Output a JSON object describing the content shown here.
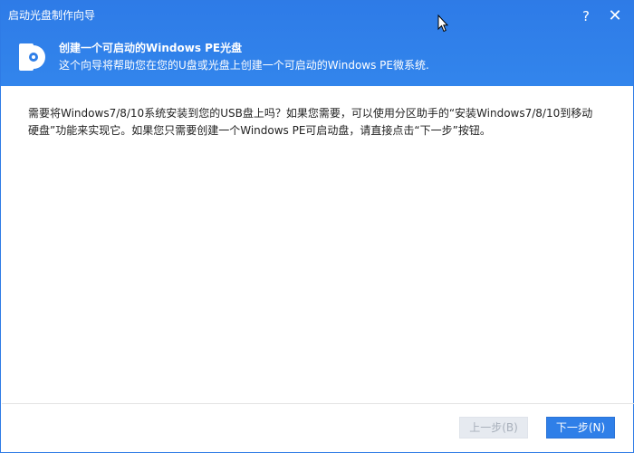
{
  "window": {
    "title": "启动光盘制作向导",
    "help_label": "?",
    "close_label": "✕"
  },
  "header": {
    "icon": "disc-icon",
    "title": "创建一个可启动的Windows PE光盘",
    "subtitle": "这个向导将帮助您在您的U盘或光盘上创建一个可启动的Windows PE微系统."
  },
  "content": {
    "paragraph_line1": "需要将Windows7/8/10系统安装到您的USB盘上吗？如果您需要，可以使用分区助手的“安装Windows7/8/10到移动",
    "paragraph_line2": "硬盘”功能来实现它。如果您只需要创建一个Windows PE可启动盘，请直接点击“下一步”按钮。"
  },
  "buttons": {
    "prev_label": "上一步(B)",
    "next_label": "下一步(N)"
  },
  "colors": {
    "header_blue": "#2f7fe8",
    "disabled_button": "#e6eaf0",
    "primary_button": "#2f7fe8"
  }
}
